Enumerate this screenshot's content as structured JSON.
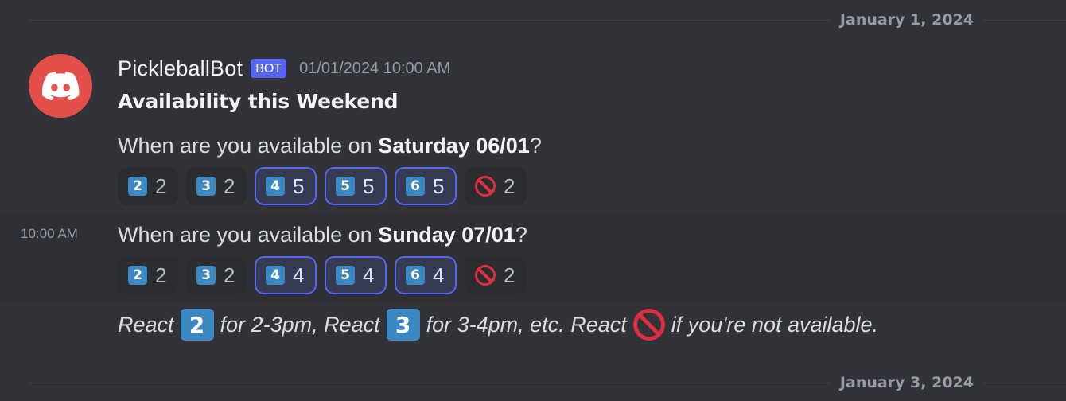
{
  "dividers": {
    "top_date": "January 1, 2024",
    "bottom_date": "January 3, 2024"
  },
  "message": {
    "avatar_icon": "discord-logo-icon",
    "author": "PickleballBot",
    "bot_tag": "BOT",
    "timestamp": "01/01/2024 10:00 AM",
    "title": "Availability this Weekend",
    "saturday": {
      "prefix": "When are you available on ",
      "day": "Saturday 06/01",
      "suffix": "?",
      "reactions": [
        {
          "emoji": "2",
          "count": "2",
          "me": false
        },
        {
          "emoji": "3",
          "count": "2",
          "me": false
        },
        {
          "emoji": "4",
          "count": "5",
          "me": true
        },
        {
          "emoji": "5",
          "count": "5",
          "me": true
        },
        {
          "emoji": "6",
          "count": "5",
          "me": true
        },
        {
          "emoji": "no-entry-icon",
          "count": "2",
          "me": false
        }
      ]
    },
    "sunday_side_time": "10:00 AM",
    "sunday": {
      "prefix": "When are you available on ",
      "day": "Sunday 07/01",
      "suffix": "?",
      "reactions": [
        {
          "emoji": "2",
          "count": "2",
          "me": false
        },
        {
          "emoji": "3",
          "count": "2",
          "me": false
        },
        {
          "emoji": "4",
          "count": "4",
          "me": true
        },
        {
          "emoji": "5",
          "count": "4",
          "me": true
        },
        {
          "emoji": "6",
          "count": "4",
          "me": true
        },
        {
          "emoji": "no-entry-icon",
          "count": "2",
          "me": false
        }
      ]
    },
    "footer": {
      "part1": "React ",
      "key1": "2",
      "part2": " for 2-3pm, React ",
      "key2": "3",
      "part3": " for 3-4pm, etc. React ",
      "part4": " if you're not available."
    }
  },
  "colors": {
    "background": "#313338",
    "avatar": "#e3504b",
    "bot_tag": "#5865f2",
    "keycap": "#3b88c3",
    "no_entry": "#dd2e44"
  }
}
